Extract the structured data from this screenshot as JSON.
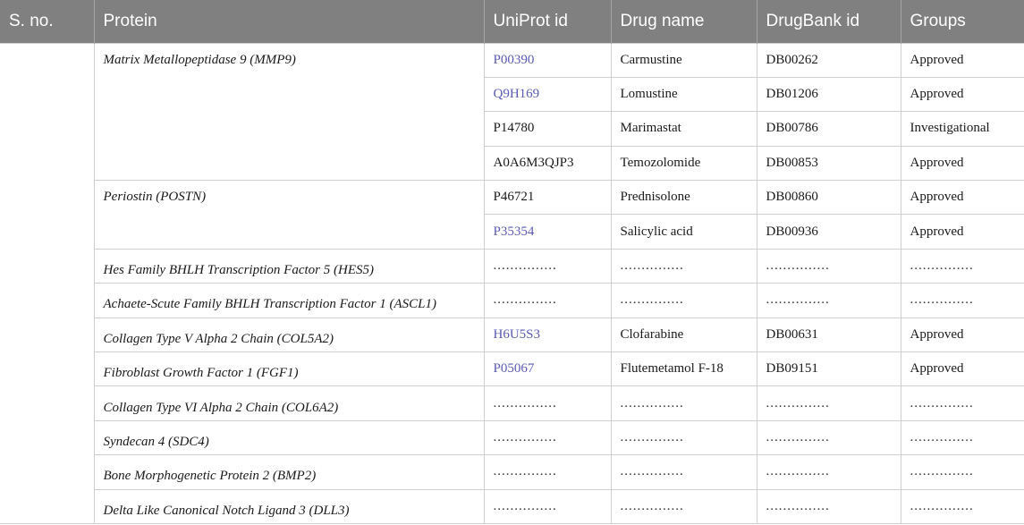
{
  "headers": [
    "S. no.",
    "Protein",
    "UniProt id",
    "Drug name",
    "DrugBank id",
    "Groups"
  ],
  "groups": [
    {
      "protein": "Matrix Metallopeptidase 9 (MMP9)",
      "rows": [
        {
          "uniprot": "P00390",
          "uniprot_link": true,
          "drug": "Carmustine",
          "drugbank": "DB00262",
          "group": "Approved"
        },
        {
          "uniprot": "Q9H169",
          "uniprot_link": true,
          "drug": "Lomustine",
          "drugbank": "DB01206",
          "group": "Approved"
        },
        {
          "uniprot": "P14780",
          "uniprot_link": false,
          "drug": "Marimastat",
          "drugbank": "DB00786",
          "group": "Investigational"
        },
        {
          "uniprot": "A0A6M3QJP3",
          "uniprot_link": false,
          "drug": "Temozolomide",
          "drugbank": "DB00853",
          "group": "Approved"
        }
      ]
    },
    {
      "protein": "Periostin (POSTN)",
      "rows": [
        {
          "uniprot": "P46721",
          "uniprot_link": false,
          "drug": "Prednisolone",
          "drugbank": "DB00860",
          "group": "Approved"
        },
        {
          "uniprot": "P35354",
          "uniprot_link": true,
          "drug": "Salicylic acid",
          "drugbank": "DB00936",
          "group": "Approved"
        }
      ]
    },
    {
      "protein": "Hes Family BHLH Transcription Factor 5 (HES5)",
      "rows": [
        {
          "uniprot": "...............",
          "uniprot_link": false,
          "drug": "...............",
          "drugbank": "...............",
          "group": "..............."
        }
      ]
    },
    {
      "protein": "Achaete-Scute Family BHLH Transcription Factor 1 (ASCL1)",
      "rows": [
        {
          "uniprot": "...............",
          "uniprot_link": false,
          "drug": "...............",
          "drugbank": "...............",
          "group": "..............."
        }
      ]
    },
    {
      "protein": "Collagen Type V Alpha 2 Chain (COL5A2)",
      "rows": [
        {
          "uniprot": "H6U5S3",
          "uniprot_link": true,
          "drug": "Clofarabine",
          "drugbank": "DB00631",
          "group": "Approved"
        }
      ]
    },
    {
      "protein": "Fibroblast Growth Factor 1 (FGF1)",
      "rows": [
        {
          "uniprot": "P05067",
          "uniprot_link": true,
          "drug": "Flutemetamol F-18",
          "drugbank": "DB09151",
          "group": "Approved"
        }
      ]
    },
    {
      "protein": "Collagen Type VI Alpha 2 Chain (COL6A2)",
      "rows": [
        {
          "uniprot": "...............",
          "uniprot_link": false,
          "drug": "...............",
          "drugbank": "...............",
          "group": "..............."
        }
      ]
    },
    {
      "protein": "Syndecan 4 (SDC4)",
      "rows": [
        {
          "uniprot": "...............",
          "uniprot_link": false,
          "drug": "...............",
          "drugbank": "...............",
          "group": "..............."
        }
      ]
    },
    {
      "protein": "Bone Morphogenetic Protein 2 (BMP2)",
      "rows": [
        {
          "uniprot": "...............",
          "uniprot_link": false,
          "drug": "...............",
          "drugbank": "...............",
          "group": "..............."
        }
      ]
    },
    {
      "protein": "Delta Like Canonical Notch Ligand 3 (DLL3)",
      "rows": [
        {
          "uniprot": "...............",
          "uniprot_link": false,
          "drug": "...............",
          "drugbank": "...............",
          "group": "..............."
        }
      ]
    }
  ]
}
